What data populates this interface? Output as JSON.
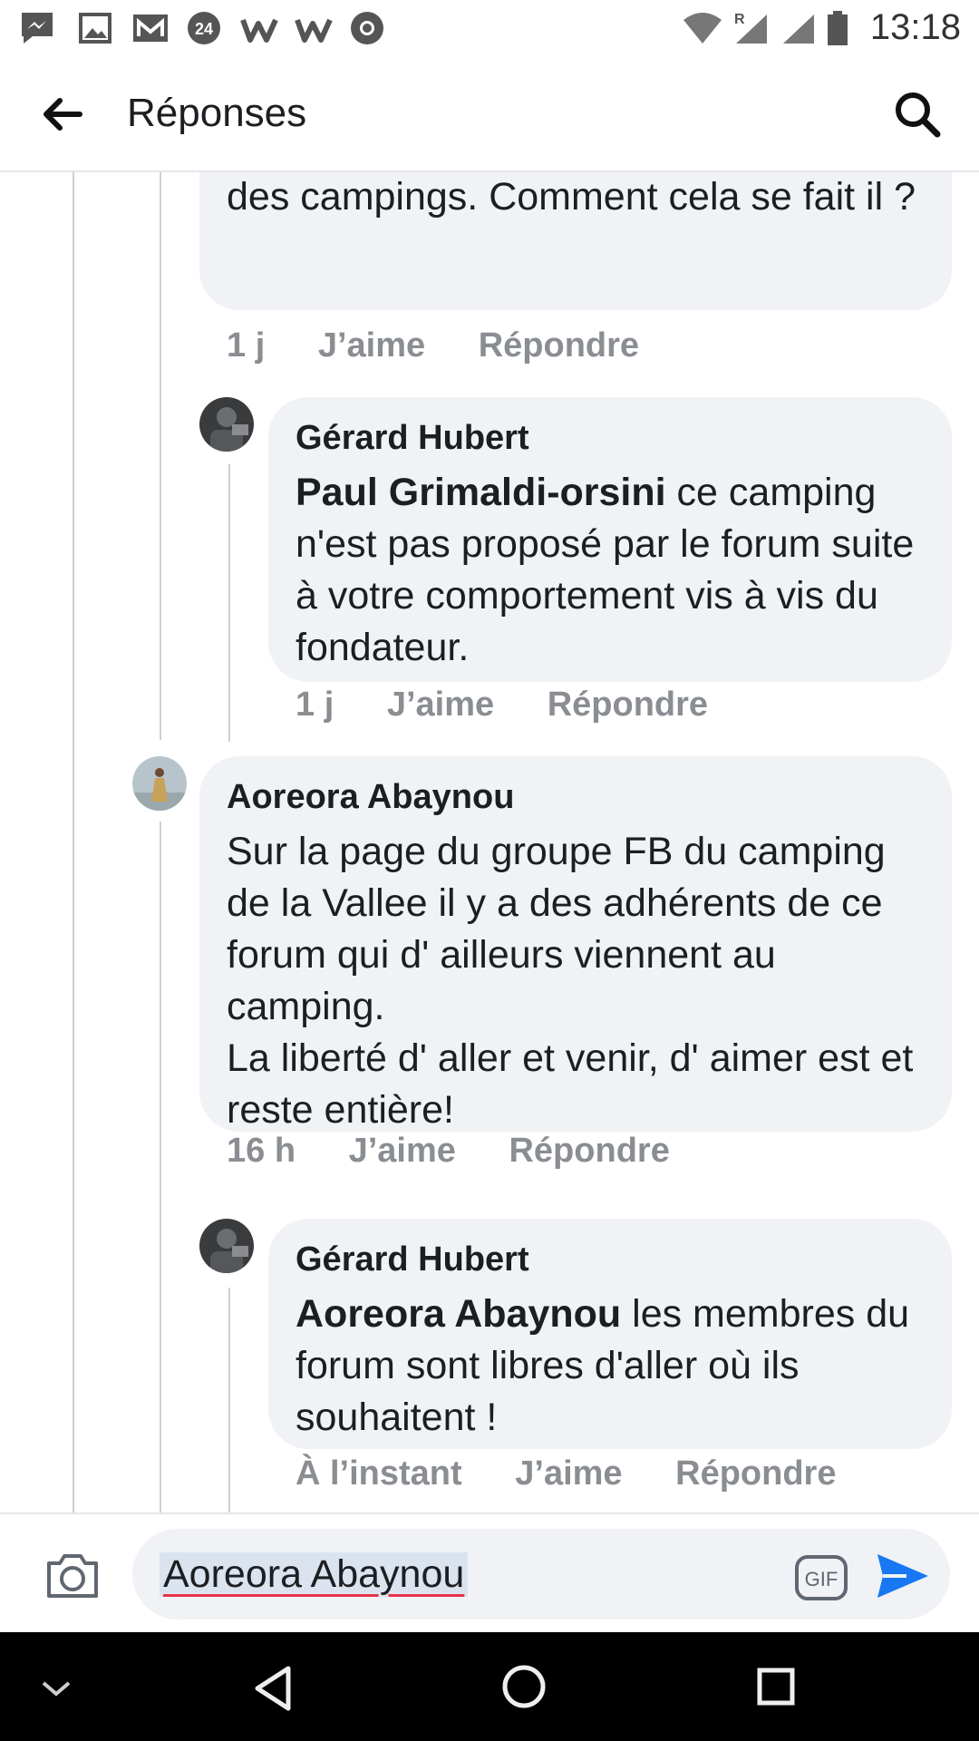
{
  "status_bar": {
    "time": "13:18",
    "icons": [
      "messenger-icon",
      "gallery-icon",
      "gmail-icon",
      "24-icon",
      "w-icon",
      "w-icon",
      "chrome-icon",
      "wifi-icon",
      "signal-roaming-icon",
      "signal-icon",
      "battery-icon"
    ]
  },
  "header": {
    "title": "Réponses",
    "icons": [
      "back-arrow-icon",
      "search-icon"
    ]
  },
  "comments": [
    {
      "text": "pas répertorié sur la carte interactive des campings.  Comment cela se fait il ?",
      "time": "1 j",
      "like": "J’aime",
      "reply": "Répondre"
    },
    {
      "author": "Gérard Hubert",
      "mention": "Paul Grimaldi-orsini",
      "text": " ce camping n'est pas proposé par le forum suite à votre comportement vis à vis du fondateur.",
      "time": "1 j",
      "like": "J’aime",
      "reply": "Répondre"
    },
    {
      "author": "Aoreora Abaynou",
      "text": "Sur la page du groupe FB du camping de la Vallee il y a des adhérents de ce forum  qui d' ailleurs viennent au camping.\nLa liberté d' aller et venir, d' aimer est et reste entière!",
      "time": "16 h",
      "like": "J’aime",
      "reply": "Répondre"
    },
    {
      "author": "Gérard Hubert",
      "mention": "Aoreora Abaynou",
      "text": " les membres du forum sont libres d'aller où ils souhaitent !",
      "time": "À l’instant",
      "like": "J’aime",
      "reply": "Répondre"
    }
  ],
  "composer": {
    "value": "Aoreora Abaynou",
    "icons": [
      "camera-icon",
      "gif-icon",
      "send-icon"
    ]
  },
  "nav": {
    "icons": [
      "chevron-down-icon",
      "back-triangle-icon",
      "home-circle-icon",
      "recents-square-icon"
    ]
  },
  "colors": {
    "bubble": "#f0f2f5",
    "meta": "#8a8d91",
    "send": "#1877f2",
    "spell_underline": "#e8324a"
  }
}
